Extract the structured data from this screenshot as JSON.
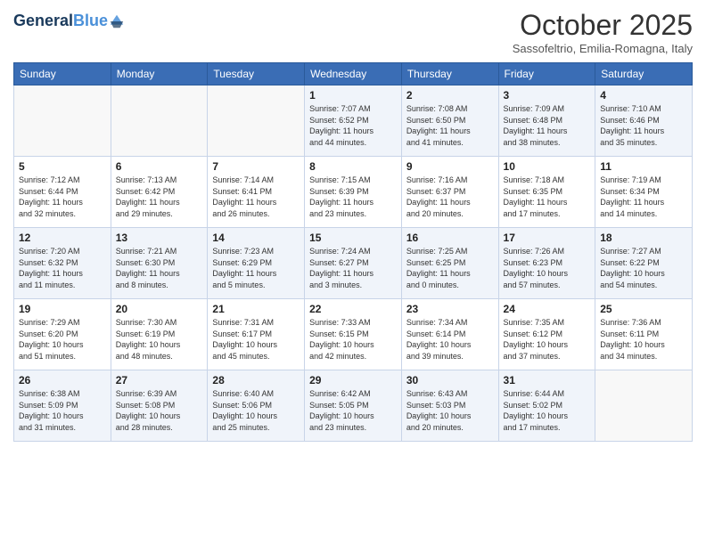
{
  "header": {
    "logo_line1": "General",
    "logo_line2": "Blue",
    "month": "October 2025",
    "location": "Sassofeltrio, Emilia-Romagna, Italy"
  },
  "days_of_week": [
    "Sunday",
    "Monday",
    "Tuesday",
    "Wednesday",
    "Thursday",
    "Friday",
    "Saturday"
  ],
  "weeks": [
    [
      {
        "day": "",
        "content": ""
      },
      {
        "day": "",
        "content": ""
      },
      {
        "day": "",
        "content": ""
      },
      {
        "day": "1",
        "content": "Sunrise: 7:07 AM\nSunset: 6:52 PM\nDaylight: 11 hours\nand 44 minutes."
      },
      {
        "day": "2",
        "content": "Sunrise: 7:08 AM\nSunset: 6:50 PM\nDaylight: 11 hours\nand 41 minutes."
      },
      {
        "day": "3",
        "content": "Sunrise: 7:09 AM\nSunset: 6:48 PM\nDaylight: 11 hours\nand 38 minutes."
      },
      {
        "day": "4",
        "content": "Sunrise: 7:10 AM\nSunset: 6:46 PM\nDaylight: 11 hours\nand 35 minutes."
      }
    ],
    [
      {
        "day": "5",
        "content": "Sunrise: 7:12 AM\nSunset: 6:44 PM\nDaylight: 11 hours\nand 32 minutes."
      },
      {
        "day": "6",
        "content": "Sunrise: 7:13 AM\nSunset: 6:42 PM\nDaylight: 11 hours\nand 29 minutes."
      },
      {
        "day": "7",
        "content": "Sunrise: 7:14 AM\nSunset: 6:41 PM\nDaylight: 11 hours\nand 26 minutes."
      },
      {
        "day": "8",
        "content": "Sunrise: 7:15 AM\nSunset: 6:39 PM\nDaylight: 11 hours\nand 23 minutes."
      },
      {
        "day": "9",
        "content": "Sunrise: 7:16 AM\nSunset: 6:37 PM\nDaylight: 11 hours\nand 20 minutes."
      },
      {
        "day": "10",
        "content": "Sunrise: 7:18 AM\nSunset: 6:35 PM\nDaylight: 11 hours\nand 17 minutes."
      },
      {
        "day": "11",
        "content": "Sunrise: 7:19 AM\nSunset: 6:34 PM\nDaylight: 11 hours\nand 14 minutes."
      }
    ],
    [
      {
        "day": "12",
        "content": "Sunrise: 7:20 AM\nSunset: 6:32 PM\nDaylight: 11 hours\nand 11 minutes."
      },
      {
        "day": "13",
        "content": "Sunrise: 7:21 AM\nSunset: 6:30 PM\nDaylight: 11 hours\nand 8 minutes."
      },
      {
        "day": "14",
        "content": "Sunrise: 7:23 AM\nSunset: 6:29 PM\nDaylight: 11 hours\nand 5 minutes."
      },
      {
        "day": "15",
        "content": "Sunrise: 7:24 AM\nSunset: 6:27 PM\nDaylight: 11 hours\nand 3 minutes."
      },
      {
        "day": "16",
        "content": "Sunrise: 7:25 AM\nSunset: 6:25 PM\nDaylight: 11 hours\nand 0 minutes."
      },
      {
        "day": "17",
        "content": "Sunrise: 7:26 AM\nSunset: 6:23 PM\nDaylight: 10 hours\nand 57 minutes."
      },
      {
        "day": "18",
        "content": "Sunrise: 7:27 AM\nSunset: 6:22 PM\nDaylight: 10 hours\nand 54 minutes."
      }
    ],
    [
      {
        "day": "19",
        "content": "Sunrise: 7:29 AM\nSunset: 6:20 PM\nDaylight: 10 hours\nand 51 minutes."
      },
      {
        "day": "20",
        "content": "Sunrise: 7:30 AM\nSunset: 6:19 PM\nDaylight: 10 hours\nand 48 minutes."
      },
      {
        "day": "21",
        "content": "Sunrise: 7:31 AM\nSunset: 6:17 PM\nDaylight: 10 hours\nand 45 minutes."
      },
      {
        "day": "22",
        "content": "Sunrise: 7:33 AM\nSunset: 6:15 PM\nDaylight: 10 hours\nand 42 minutes."
      },
      {
        "day": "23",
        "content": "Sunrise: 7:34 AM\nSunset: 6:14 PM\nDaylight: 10 hours\nand 39 minutes."
      },
      {
        "day": "24",
        "content": "Sunrise: 7:35 AM\nSunset: 6:12 PM\nDaylight: 10 hours\nand 37 minutes."
      },
      {
        "day": "25",
        "content": "Sunrise: 7:36 AM\nSunset: 6:11 PM\nDaylight: 10 hours\nand 34 minutes."
      }
    ],
    [
      {
        "day": "26",
        "content": "Sunrise: 6:38 AM\nSunset: 5:09 PM\nDaylight: 10 hours\nand 31 minutes."
      },
      {
        "day": "27",
        "content": "Sunrise: 6:39 AM\nSunset: 5:08 PM\nDaylight: 10 hours\nand 28 minutes."
      },
      {
        "day": "28",
        "content": "Sunrise: 6:40 AM\nSunset: 5:06 PM\nDaylight: 10 hours\nand 25 minutes."
      },
      {
        "day": "29",
        "content": "Sunrise: 6:42 AM\nSunset: 5:05 PM\nDaylight: 10 hours\nand 23 minutes."
      },
      {
        "day": "30",
        "content": "Sunrise: 6:43 AM\nSunset: 5:03 PM\nDaylight: 10 hours\nand 20 minutes."
      },
      {
        "day": "31",
        "content": "Sunrise: 6:44 AM\nSunset: 5:02 PM\nDaylight: 10 hours\nand 17 minutes."
      },
      {
        "day": "",
        "content": ""
      }
    ]
  ]
}
